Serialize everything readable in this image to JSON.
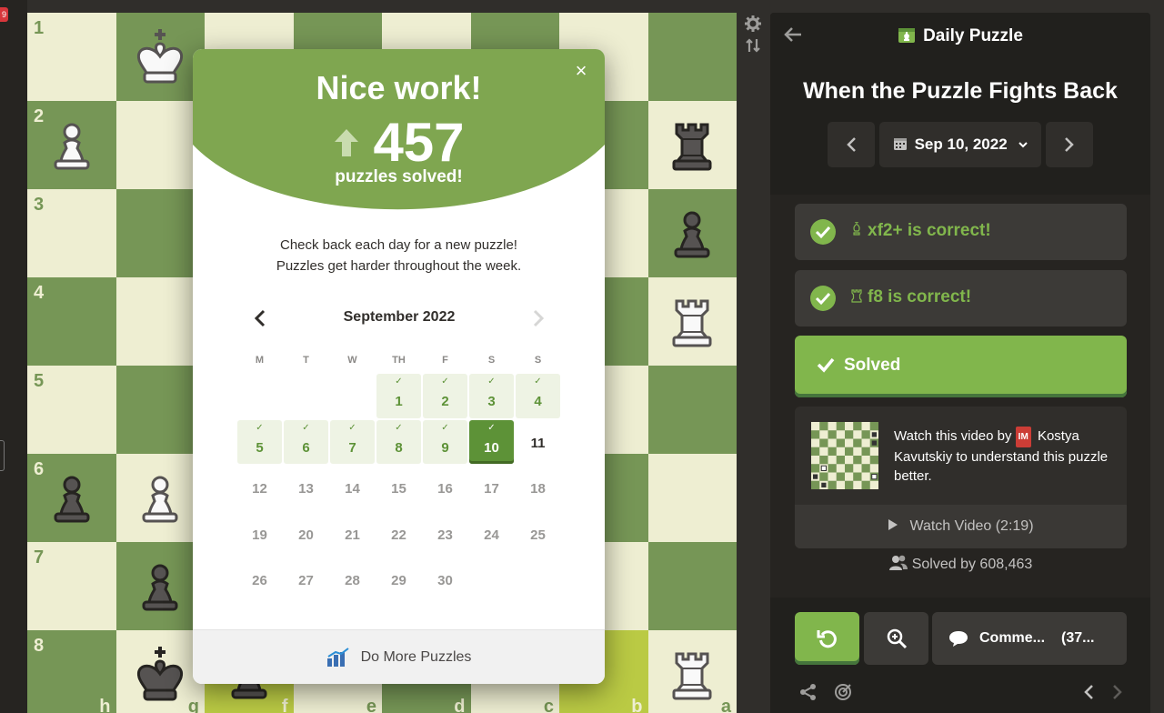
{
  "left": {
    "badge": "9"
  },
  "board": {
    "ranks": [
      "1",
      "2",
      "3",
      "4",
      "5",
      "6",
      "7",
      "8"
    ],
    "files": [
      "h",
      "g",
      "f",
      "e",
      "d",
      "c",
      "b",
      "a"
    ],
    "pieces": [
      {
        "square": "g1",
        "piece": "white-king"
      },
      {
        "square": "h2",
        "piece": "white-pawn"
      },
      {
        "square": "a2",
        "piece": "black-rook"
      },
      {
        "square": "a3",
        "piece": "black-pawn"
      },
      {
        "square": "a4",
        "piece": "white-rook"
      },
      {
        "square": "h6",
        "piece": "black-pawn"
      },
      {
        "square": "g6",
        "piece": "white-pawn"
      },
      {
        "square": "g7",
        "piece": "black-pawn"
      },
      {
        "square": "g8",
        "piece": "black-king"
      },
      {
        "square": "f8",
        "piece": "black-pawn"
      },
      {
        "square": "a8",
        "piece": "white-rook"
      }
    ],
    "colors": {
      "light": "#eeeed2",
      "dark": "#769656",
      "highlight": "#baca44"
    }
  },
  "modal": {
    "headline": "Nice work!",
    "solved_count": "457",
    "solved_label": "puzzles solved!",
    "message_line1": "Check back each day for a new puzzle!",
    "message_line2": "Puzzles get harder throughout the week.",
    "close_glyph": "×",
    "calendar": {
      "month": "September 2022",
      "weekdays": [
        "M",
        "T",
        "W",
        "TH",
        "F",
        "S",
        "S"
      ],
      "leading_blanks": 3,
      "days": [
        {
          "n": "1",
          "state": "solved"
        },
        {
          "n": "2",
          "state": "solved"
        },
        {
          "n": "3",
          "state": "solved"
        },
        {
          "n": "4",
          "state": "solved"
        },
        {
          "n": "5",
          "state": "solved"
        },
        {
          "n": "6",
          "state": "solved"
        },
        {
          "n": "7",
          "state": "solved"
        },
        {
          "n": "8",
          "state": "solved"
        },
        {
          "n": "9",
          "state": "solved"
        },
        {
          "n": "10",
          "state": "today"
        },
        {
          "n": "11",
          "state": "available"
        },
        {
          "n": "12",
          "state": "future"
        },
        {
          "n": "13",
          "state": "future"
        },
        {
          "n": "14",
          "state": "future"
        },
        {
          "n": "15",
          "state": "future"
        },
        {
          "n": "16",
          "state": "future"
        },
        {
          "n": "17",
          "state": "future"
        },
        {
          "n": "18",
          "state": "future"
        },
        {
          "n": "19",
          "state": "future"
        },
        {
          "n": "20",
          "state": "future"
        },
        {
          "n": "21",
          "state": "future"
        },
        {
          "n": "22",
          "state": "future"
        },
        {
          "n": "23",
          "state": "future"
        },
        {
          "n": "24",
          "state": "future"
        },
        {
          "n": "25",
          "state": "future"
        },
        {
          "n": "26",
          "state": "future"
        },
        {
          "n": "27",
          "state": "future"
        },
        {
          "n": "28",
          "state": "future"
        },
        {
          "n": "29",
          "state": "future"
        },
        {
          "n": "30",
          "state": "future"
        }
      ]
    },
    "footer_label": "Do More Puzzles",
    "colors": {
      "header": "#7fa650",
      "accent": "#5d9237"
    }
  },
  "panel": {
    "title": "Daily Puzzle",
    "puzzle_name": "When the Puzzle Fights Back",
    "date": "Sep 10, 2022",
    "moves": [
      {
        "text": "xf2+ is correct!",
        "piece_icon": "bishop-icon"
      },
      {
        "text": "f8 is correct!",
        "piece_icon": "rook-icon"
      }
    ],
    "solved_button": "Solved",
    "video": {
      "text_before": "Watch this video by",
      "badge": "IM",
      "text_after": "Kostya Kavutskiy to understand this puzzle better.",
      "button": "Watch Video (2:19)"
    },
    "solved_by": "Solved by 608,463",
    "comments_label": "Comme...",
    "comments_count": "(37...",
    "colors": {
      "green": "#81b64c",
      "panel_bg": "#262421"
    }
  }
}
